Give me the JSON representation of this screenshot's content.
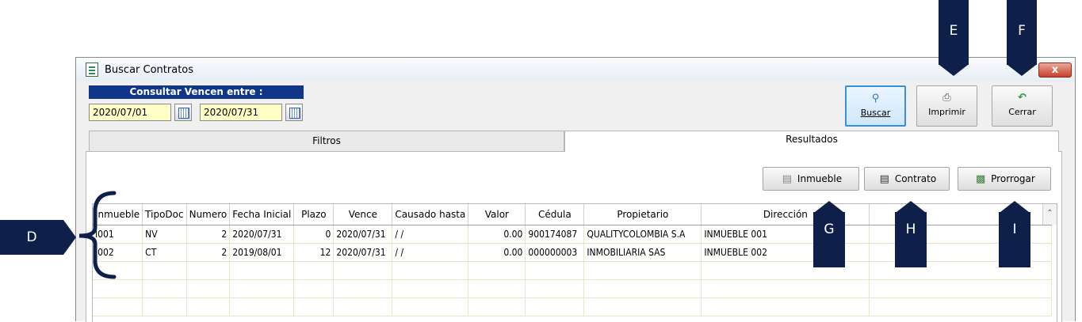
{
  "window": {
    "title": "Buscar Contratos",
    "close_label": "x"
  },
  "filter": {
    "header": "Consultar  Vencen entre :",
    "date_from": "2020/07/01",
    "date_to": "2020/07/31"
  },
  "toolbar": {
    "buscar": "Buscar",
    "imprimir": "Imprimir",
    "cerrar": "Cerrar"
  },
  "tabs": {
    "filtros": "Filtros",
    "resultados": "Resultados"
  },
  "actions": {
    "inmueble": "Inmueble",
    "contrato": "Contrato",
    "prorrogar": "Prorrogar"
  },
  "grid": {
    "headers": [
      "Inmueble",
      "TipoDoc",
      "Numero",
      "Fecha Inicial",
      "Plazo",
      "Vence",
      "Causado hasta",
      "Valor",
      "Cédula",
      "Propietario",
      "Dirección"
    ],
    "rows": [
      [
        "I001",
        "NV",
        "2",
        "2020/07/31",
        "0",
        "2020/07/31",
        "/  /",
        "0.00",
        "900174087",
        "QUALITYCOLOMBIA S.A",
        "INMUEBLE 001"
      ],
      [
        "I002",
        "CT",
        "2",
        "2019/08/01",
        "12",
        "2020/07/31",
        "/  /",
        "0.00",
        "000000003",
        "INMOBILIARIA SAS",
        "INMUEBLE 002"
      ]
    ]
  },
  "callouts": {
    "d": "D",
    "e": "E",
    "f": "F",
    "g": "G",
    "h": "H",
    "i": "I"
  },
  "colors": {
    "callout": "#0e1f4a",
    "header_bar": "#10368a",
    "date_bg": "#ffffc6"
  }
}
